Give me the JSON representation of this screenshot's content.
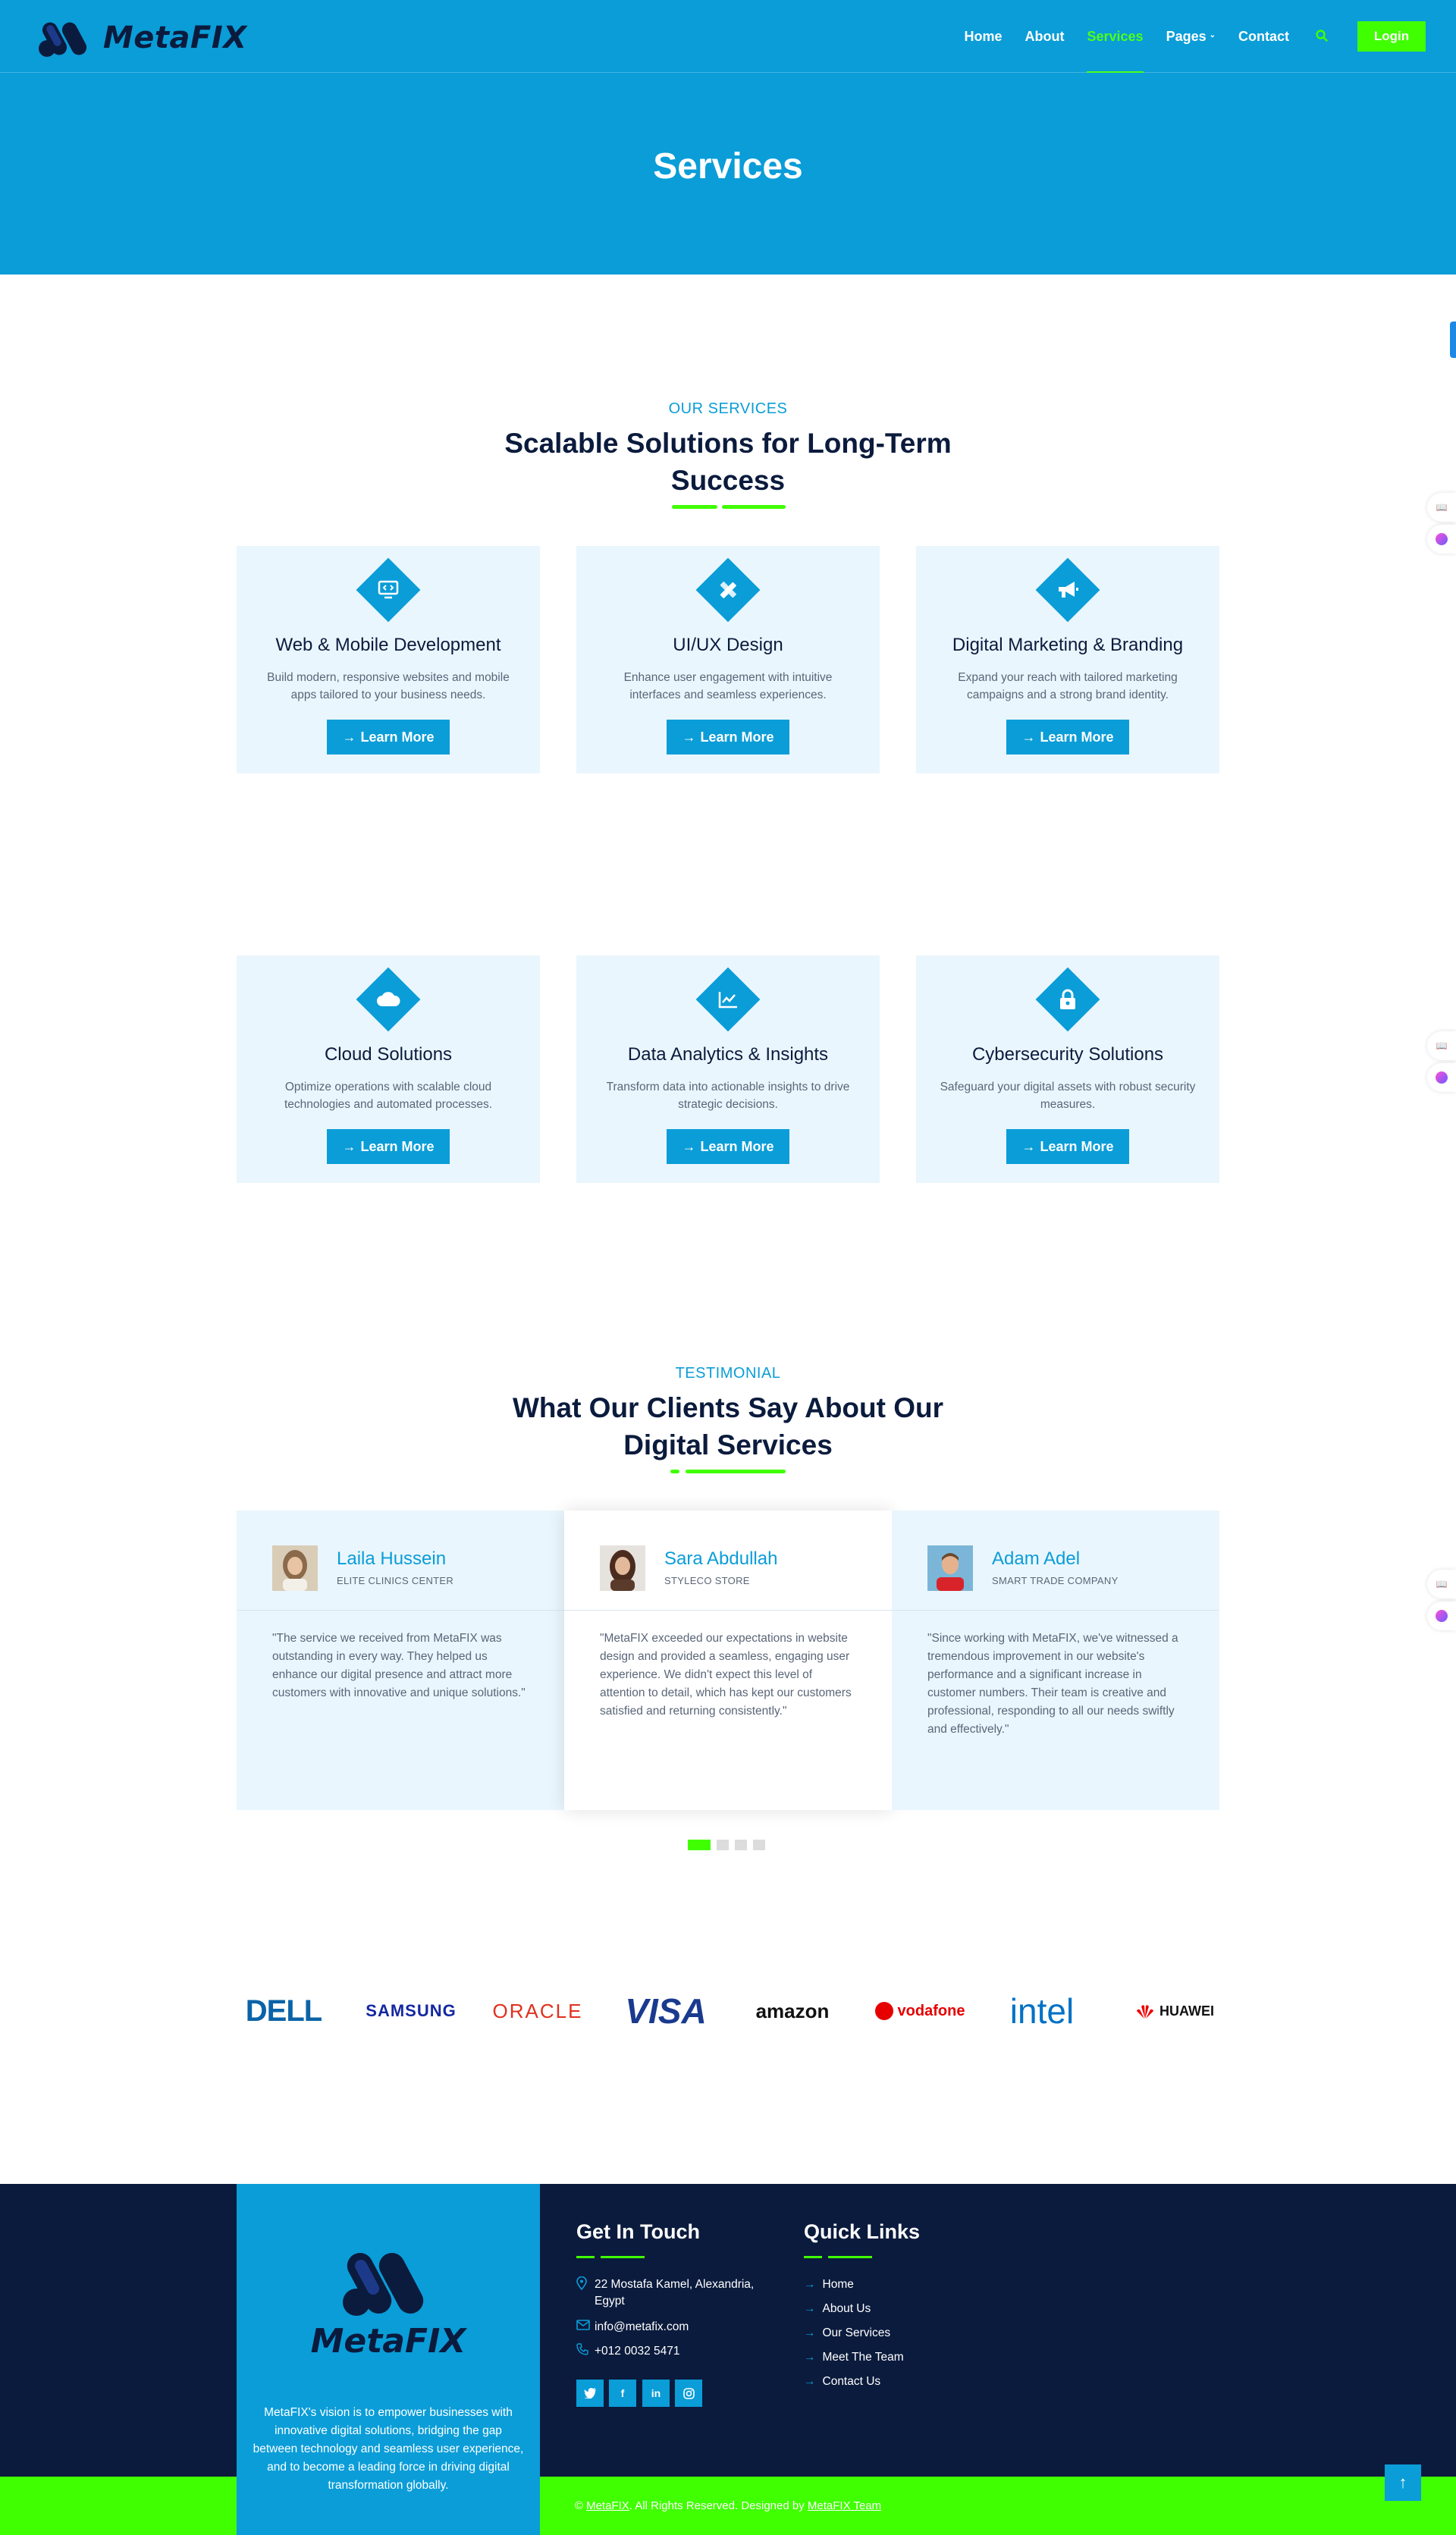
{
  "nav": {
    "logo_text": "MetaFIX",
    "items": [
      {
        "label": "Home"
      },
      {
        "label": "About"
      },
      {
        "label": "Services"
      },
      {
        "label": "Pages"
      },
      {
        "label": "Contact"
      }
    ],
    "active": "Services",
    "login": "Login"
  },
  "hero": {
    "title": "Services"
  },
  "services": {
    "tag": "OUR SERVICES",
    "title": "Scalable Solutions for Long-Term Success",
    "items": [
      {
        "title": "Web & Mobile Development",
        "desc": "Build modern, responsive websites and mobile apps tailored to your business needs.",
        "button": "Learn More",
        "icon": "monitor-code-icon"
      },
      {
        "title": "UI/UX Design",
        "desc": "Enhance user engagement with intuitive interfaces and seamless experiences.",
        "button": "Learn More",
        "icon": "pencil-ruler-icon"
      },
      {
        "title": "Digital Marketing & Branding",
        "desc": "Expand your reach with tailored marketing campaigns and a strong brand identity.",
        "button": "Learn More",
        "icon": "megaphone-icon"
      },
      {
        "title": "Cloud Solutions",
        "desc": "Optimize operations with scalable cloud technologies and automated processes.",
        "button": "Learn More",
        "icon": "cloud-icon"
      },
      {
        "title": "Data Analytics & Insights",
        "desc": "Transform data into actionable insights to drive strategic decisions.",
        "button": "Learn More",
        "icon": "chart-line-icon"
      },
      {
        "title": "Cybersecurity Solutions",
        "desc": "Safeguard your digital assets with robust security measures.",
        "button": "Learn More",
        "icon": "lock-icon"
      }
    ]
  },
  "testimonials": {
    "tag": "TESTIMONIAL",
    "title": "What Our Clients Say About Our Digital Services",
    "items": [
      {
        "name": "Laila Hussein",
        "company": "ELITE CLINICS CENTER",
        "quote": "\"The service we received from MetaFIX was outstanding in every way. They helped us enhance our digital presence and attract more customers with innovative and unique solutions.\""
      },
      {
        "name": "Sara Abdullah",
        "company": "STYLECO STORE",
        "quote": "\"MetaFIX exceeded our expectations in website design and provided a seamless, engaging user experience. We didn't expect this level of attention to detail, which has kept our customers satisfied and returning consistently.\""
      },
      {
        "name": "Adam Adel",
        "company": "SMART TRADE COMPANY",
        "quote": "\"Since working with MetaFIX, we've witnessed a tremendous improvement in our website's performance and a significant increase in customer numbers. Their team is creative and professional, responding to all our needs swiftly and effectively.\""
      }
    ],
    "pages": 4,
    "active_page": 1
  },
  "brands": [
    "DELL",
    "SAMSUNG",
    "ORACLE",
    "VISA",
    "amazon",
    "vodafone",
    "intel",
    "HUAWEI"
  ],
  "footer": {
    "logo_text": "MetaFIX",
    "description": "MetaFIX's vision is to empower businesses with innovative digital solutions, bridging the gap between technology and seamless user experience, and to become a leading force in driving digital transformation globally.",
    "contact_title": "Get In Touch",
    "address": "22 Mostafa Kamel, Alexandria, Egypt",
    "email": "info@metafix.com",
    "phone": "+012 0032 5471",
    "social": [
      "twitter",
      "facebook",
      "linkedin",
      "instagram"
    ],
    "links_title": "Quick Links",
    "links": [
      "Home",
      "About Us",
      "Our Services",
      "Meet The Team",
      "Contact Us"
    ],
    "copyright_pre": "©",
    "copyright_brand": "MetaFIX",
    "copyright_mid": ". All Rights Reserved. Designed by",
    "copyright_team": "MetaFIX Team"
  },
  "colors": {
    "primary": "#0a9dd8",
    "accent": "#40ff00",
    "dark": "#0b1b3d",
    "card": "#eaf6fd"
  }
}
